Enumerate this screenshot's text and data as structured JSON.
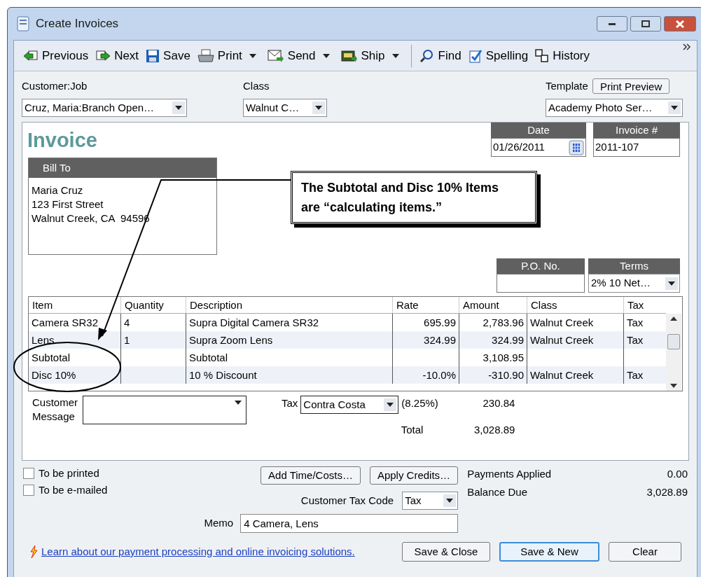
{
  "window": {
    "title": "Create Invoices"
  },
  "toolbar": [
    {
      "label": "Previous",
      "kind": "previous",
      "dropdown": false
    },
    {
      "label": "Next",
      "kind": "next",
      "dropdown": false
    },
    {
      "label": "Save",
      "kind": "save",
      "dropdown": false
    },
    {
      "label": "Print",
      "kind": "print",
      "dropdown": true
    },
    {
      "label": "Send",
      "kind": "send",
      "dropdown": true
    },
    {
      "label": "Ship",
      "kind": "ship",
      "dropdown": true
    },
    {
      "label": "Find",
      "kind": "find",
      "dropdown": false
    },
    {
      "label": "Spelling",
      "kind": "spelling",
      "dropdown": false
    },
    {
      "label": "History",
      "kind": "history",
      "dropdown": false
    }
  ],
  "header": {
    "customer_job": {
      "label": "Customer:Job",
      "value": "Cruz, Maria:Branch Open…"
    },
    "class": {
      "label": "Class",
      "value": "Walnut C…"
    },
    "template": {
      "label": "Template",
      "button": "Print Preview",
      "value": "Academy Photo Ser…"
    }
  },
  "invoice": {
    "title": "Invoice",
    "date": {
      "label": "Date",
      "value": "01/26/2011"
    },
    "invoice_number": {
      "label": "Invoice #",
      "value": "2011-107"
    },
    "bill_to": {
      "label": "Bill To",
      "lines": [
        "Maria Cruz",
        "123 First Street",
        "Walnut Creek, CA  94596"
      ]
    },
    "po_number": {
      "label": "P.O. No."
    },
    "terms": {
      "label": "Terms",
      "value": "2% 10 Net…"
    }
  },
  "table": {
    "columns": [
      "Item",
      "Quantity",
      "Description",
      "Rate",
      "Amount",
      "Class",
      "Tax"
    ],
    "rows": [
      [
        "Camera SR32",
        "4",
        "Supra Digital Camera SR32",
        "695.99",
        "2,783.96",
        "Walnut Creek",
        "Tax"
      ],
      [
        "Lens",
        "1",
        "Supra Zoom Lens",
        "324.99",
        "324.99",
        "Walnut Creek",
        "Tax"
      ],
      [
        "Subtotal",
        "",
        "Subtotal",
        "",
        "3,108.95",
        "",
        ""
      ],
      [
        "Disc 10%",
        "",
        "10 % Discount",
        "-10.0%",
        "-310.90",
        "Walnut Creek",
        "Tax"
      ]
    ]
  },
  "totals": {
    "customer_message": {
      "label": "Customer Message"
    },
    "tax": {
      "label": "Tax",
      "value": "Contra Costa",
      "rate": "(8.25%)",
      "amount": "230.84"
    },
    "total": {
      "label": "Total",
      "value": "3,028.89"
    }
  },
  "bottom": {
    "checkboxes": [
      {
        "label": "To be printed",
        "checked": false
      },
      {
        "label": "To be e-mailed",
        "checked": false
      }
    ],
    "buttons": [
      "Add Time/Costs…",
      "Apply Credits…"
    ],
    "customer_tax_code": {
      "label": "Customer Tax Code",
      "value": "Tax"
    },
    "memo": {
      "label": "Memo",
      "value": "4 Camera, Lens"
    },
    "payments_applied": {
      "label": "Payments Applied",
      "value": "0.00"
    },
    "balance_due": {
      "label": "Balance Due",
      "value": "3,028.89"
    },
    "link": "Learn about our payment processing and online invoicing solutions.",
    "actions": [
      {
        "label": "Save & Close",
        "default": false
      },
      {
        "label": "Save & New",
        "default": true
      },
      {
        "label": "Clear",
        "default": false
      }
    ]
  },
  "annotation": {
    "text": "The Subtotal and Disc 10% Items are “calculating items.”"
  }
}
